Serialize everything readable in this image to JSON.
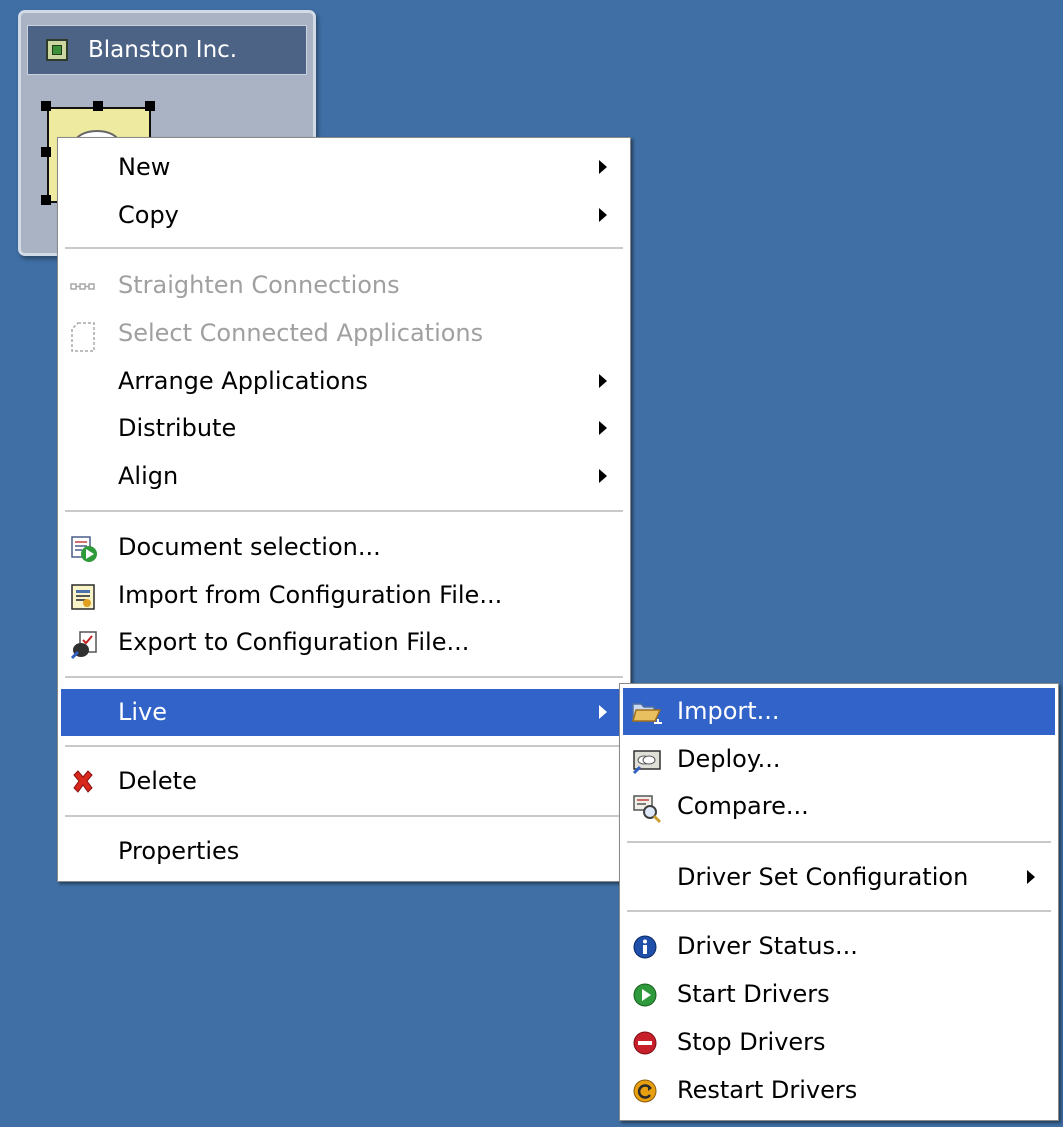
{
  "driverset": {
    "title": "Blanston Inc."
  },
  "context_menu": {
    "items": [
      {
        "label": "New",
        "submenu": true
      },
      {
        "label": "Copy",
        "submenu": true
      },
      {
        "label": "Straighten Connections",
        "disabled": true,
        "icon": "straighten-connections-icon"
      },
      {
        "label": "Select Connected Applications",
        "disabled": true,
        "icon": "select-connected-icon"
      },
      {
        "label": "Arrange Applications",
        "submenu": true
      },
      {
        "label": "Distribute",
        "submenu": true
      },
      {
        "label": "Align",
        "submenu": true
      },
      {
        "label": "Document selection...",
        "icon": "document-selection-icon"
      },
      {
        "label": "Import from Configuration File...",
        "icon": "import-config-icon"
      },
      {
        "label": "Export to Configuration File...",
        "icon": "export-config-icon"
      },
      {
        "label": "Live",
        "submenu": true,
        "highlighted": true
      },
      {
        "label": "Delete",
        "icon": "delete-icon"
      },
      {
        "label": "Properties"
      }
    ]
  },
  "live_submenu": {
    "items": [
      {
        "label": "Import...",
        "icon": "folder-open-icon",
        "highlighted": true
      },
      {
        "label": "Deploy...",
        "icon": "deploy-icon"
      },
      {
        "label": "Compare...",
        "icon": "compare-icon"
      },
      {
        "label": "Driver Set Configuration",
        "submenu": true
      },
      {
        "label": "Driver Status...",
        "icon": "info-icon"
      },
      {
        "label": "Start Drivers",
        "icon": "start-icon"
      },
      {
        "label": "Stop Drivers",
        "icon": "stop-icon"
      },
      {
        "label": "Restart Drivers",
        "icon": "restart-icon"
      }
    ]
  },
  "colors": {
    "desktop": "#3f6fa4",
    "highlight": "#3163c9",
    "disabled_text": "#a0a0a0"
  }
}
